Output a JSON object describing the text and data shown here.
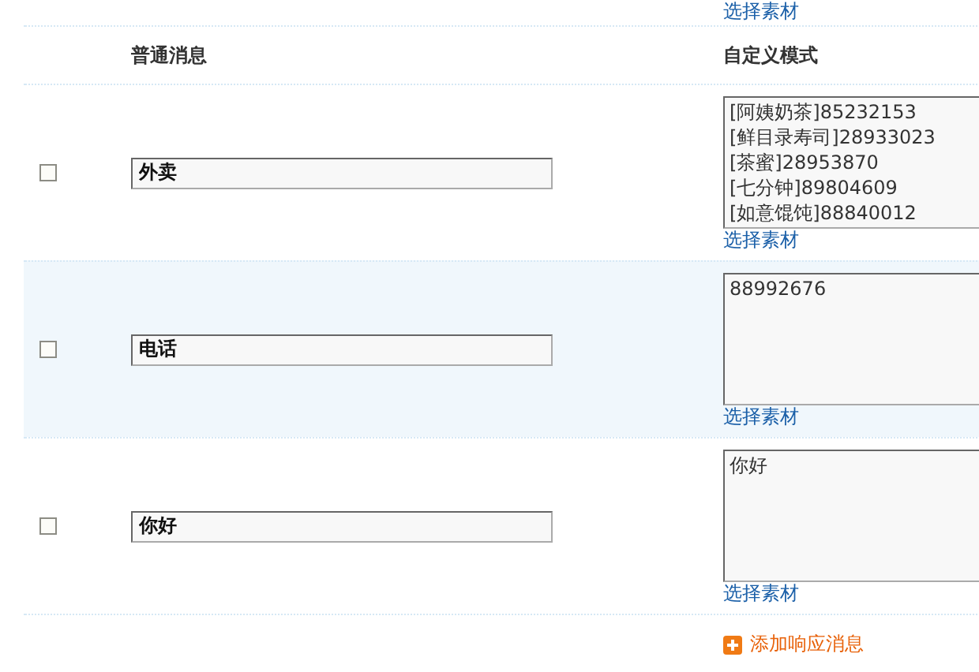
{
  "top_link": "选择素材",
  "columns": [
    "普通消息",
    "自定义模式"
  ],
  "rows": [
    {
      "checked": false,
      "selected": false,
      "keyword": "外卖",
      "reply": "[阿姨奶茶]85232153\n[鲜目录寿司]28933023\n[茶蜜]28953870\n[七分钟]89804609\n[如意馄饨]88840012",
      "link": "选择素材"
    },
    {
      "checked": false,
      "selected": true,
      "keyword": "电话",
      "reply": "88992676",
      "link": "选择素材"
    },
    {
      "checked": false,
      "selected": false,
      "keyword": "你好",
      "reply": "你好",
      "link": "选择素材"
    }
  ],
  "add_button": "添加响应消息"
}
